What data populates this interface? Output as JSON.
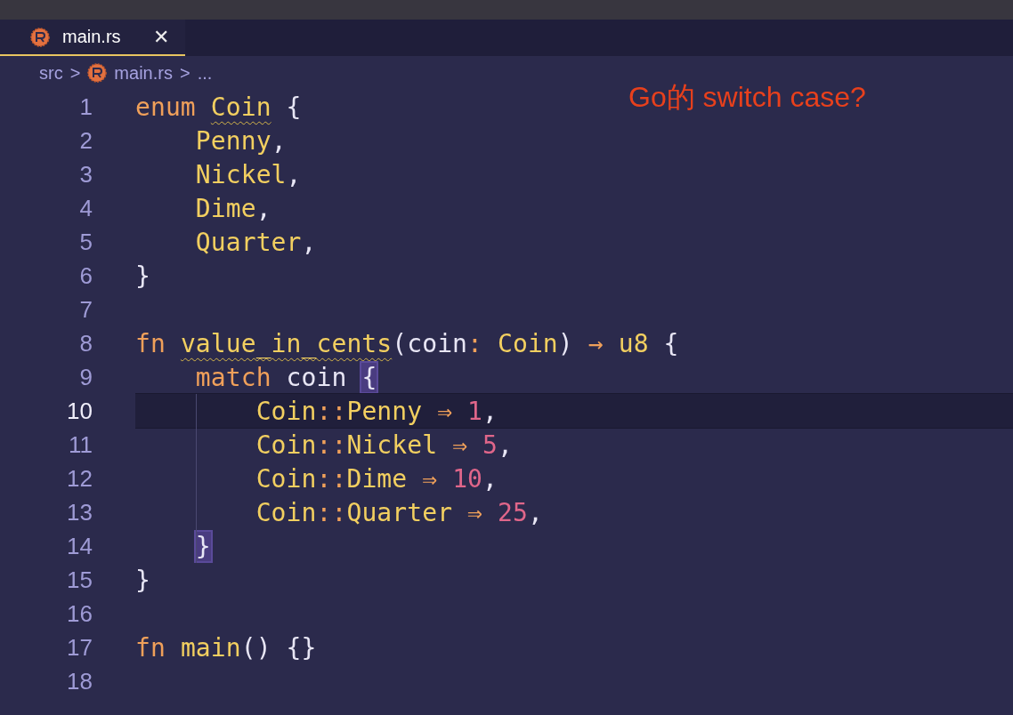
{
  "tabs": [
    {
      "label": "main.rs",
      "selected": true,
      "close": "✕"
    }
  ],
  "breadcrumb": {
    "folder": "src",
    "separator": ">",
    "file": "main.rs",
    "symbol": "..."
  },
  "annotation": "Go的 switch case?",
  "editor": {
    "lines": [
      {
        "number": "1",
        "current": false,
        "tokens": [
          {
            "kind": "keyword",
            "text": "enum "
          },
          {
            "kind": "type",
            "text": "Coin",
            "squiggle": true
          },
          {
            "kind": "plain",
            "text": " {"
          }
        ]
      },
      {
        "number": "2",
        "current": false,
        "tokens": [
          {
            "kind": "type",
            "text": "    Penny"
          },
          {
            "kind": "plain",
            "text": ","
          }
        ]
      },
      {
        "number": "3",
        "current": false,
        "tokens": [
          {
            "kind": "type",
            "text": "    Nickel"
          },
          {
            "kind": "plain",
            "text": ","
          }
        ]
      },
      {
        "number": "4",
        "current": false,
        "tokens": [
          {
            "kind": "type",
            "text": "    Dime"
          },
          {
            "kind": "plain",
            "text": ","
          }
        ]
      },
      {
        "number": "5",
        "current": false,
        "tokens": [
          {
            "kind": "type",
            "text": "    Quarter"
          },
          {
            "kind": "plain",
            "text": ","
          }
        ]
      },
      {
        "number": "6",
        "current": false,
        "tokens": [
          {
            "kind": "plain",
            "text": "}"
          }
        ]
      },
      {
        "number": "7",
        "current": false
      },
      {
        "number": "8",
        "current": false,
        "tokens": [
          {
            "kind": "keyword",
            "text": "fn "
          },
          {
            "kind": "function",
            "text": "value_in_cents",
            "squiggle": true
          },
          {
            "kind": "plain",
            "text": "(coin"
          },
          {
            "kind": "operator",
            "text": ": "
          },
          {
            "kind": "type",
            "text": "Coin"
          },
          {
            "kind": "plain",
            "text": ") "
          },
          {
            "kind": "operator",
            "text": "→ "
          },
          {
            "kind": "type",
            "text": "u8"
          },
          {
            "kind": "plain",
            "text": " {"
          }
        ]
      },
      {
        "number": "9",
        "current": false,
        "tokens": [
          {
            "kind": "keyword",
            "text": "    match"
          },
          {
            "kind": "plain",
            "text": " coin "
          },
          {
            "kind": "plain",
            "text": "{",
            "bracket_match": true
          }
        ]
      },
      {
        "number": "10",
        "current": true,
        "tokens": [
          {
            "kind": "type",
            "text": "        Coin"
          },
          {
            "kind": "operator",
            "text": "::"
          },
          {
            "kind": "type",
            "text": "Penny "
          },
          {
            "kind": "operator",
            "text": "⇒ "
          },
          {
            "kind": "number",
            "text": "1"
          },
          {
            "kind": "plain",
            "text": ","
          }
        ]
      },
      {
        "number": "11",
        "current": false,
        "tokens": [
          {
            "kind": "type",
            "text": "        Coin"
          },
          {
            "kind": "operator",
            "text": "::"
          },
          {
            "kind": "type",
            "text": "Nickel "
          },
          {
            "kind": "operator",
            "text": "⇒ "
          },
          {
            "kind": "number",
            "text": "5"
          },
          {
            "kind": "plain",
            "text": ","
          }
        ]
      },
      {
        "number": "12",
        "current": false,
        "tokens": [
          {
            "kind": "type",
            "text": "        Coin"
          },
          {
            "kind": "operator",
            "text": "::"
          },
          {
            "kind": "type",
            "text": "Dime "
          },
          {
            "kind": "operator",
            "text": "⇒ "
          },
          {
            "kind": "number",
            "text": "10"
          },
          {
            "kind": "plain",
            "text": ","
          }
        ]
      },
      {
        "number": "13",
        "current": false,
        "tokens": [
          {
            "kind": "type",
            "text": "        Coin"
          },
          {
            "kind": "operator",
            "text": "::"
          },
          {
            "kind": "type",
            "text": "Quarter "
          },
          {
            "kind": "operator",
            "text": "⇒ "
          },
          {
            "kind": "number",
            "text": "25"
          },
          {
            "kind": "plain",
            "text": ","
          }
        ]
      },
      {
        "number": "14",
        "current": false,
        "tokens": [
          {
            "kind": "plain",
            "text": "    }",
            "bracket_match": true
          }
        ]
      },
      {
        "number": "15",
        "current": false,
        "tokens": [
          {
            "kind": "plain",
            "text": "}"
          }
        ]
      },
      {
        "number": "16",
        "current": false
      },
      {
        "number": "17",
        "current": false,
        "tokens": [
          {
            "kind": "keyword",
            "text": "fn "
          },
          {
            "kind": "function",
            "text": "main"
          },
          {
            "kind": "plain",
            "text": "() {}"
          }
        ]
      },
      {
        "number": "18",
        "current": false
      }
    ]
  }
}
